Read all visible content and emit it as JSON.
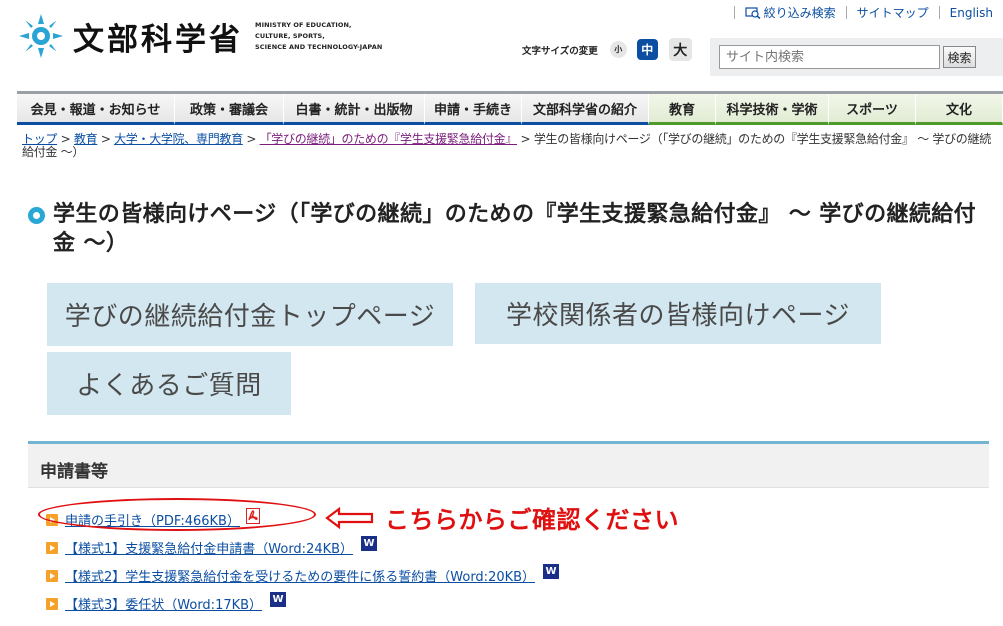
{
  "header": {
    "logo_jp": "文部科学省",
    "logo_en_lines": [
      "MINISTRY OF EDUCATION,",
      "CULTURE, SPORTS,",
      "SCIENCE AND TECHNOLOGY-JAPAN"
    ],
    "toplinks": [
      "絞り込み検索",
      "サイトマップ",
      "English"
    ],
    "fontsize_label": "文字サイズの変更",
    "fontsize_options": [
      "小",
      "中",
      "大"
    ],
    "search_placeholder": "サイト内検索",
    "search_button": "検索"
  },
  "nav": [
    {
      "label": "会見・報道・お知らせ",
      "theme": "blue"
    },
    {
      "label": "政策・審議会",
      "theme": "blue"
    },
    {
      "label": "白書・統計・出版物",
      "theme": "blue"
    },
    {
      "label": "申請・手続き",
      "theme": "blue"
    },
    {
      "label": "文部科学省の紹介",
      "theme": "blue"
    },
    {
      "label": "教育",
      "theme": "green"
    },
    {
      "label": "科学技術・学術",
      "theme": "green"
    },
    {
      "label": "スポーツ",
      "theme": "green"
    },
    {
      "label": "文化",
      "theme": "green"
    }
  ],
  "breadcrumb": {
    "links": [
      "トップ",
      "教育",
      "大学・大学院、専門教育",
      "「学びの継続」のための『学生支援緊急給付金』"
    ],
    "separator": " > ",
    "current": "学生の皆様向けページ（「学びの継続」のための『学生支援緊急給付金』 ～ 学びの継続給付金 ～）"
  },
  "page_title": "学生の皆様向けページ（「学びの継続」のための『学生支援緊急給付金』 ～ 学びの継続給付金 ～）",
  "big_buttons": [
    "学びの継続給付金トップページ",
    "学校関係者の皆様向けページ",
    "よくあるご質問"
  ],
  "section_title": "申請書等",
  "documents": [
    {
      "label": "申請の手引き（PDF:466KB）",
      "icon": "pdf-icon"
    },
    {
      "label": "【様式1】支援緊急給付金申請書（Word:24KB）",
      "icon": "word-icon"
    },
    {
      "label": "【様式2】学生支援緊急給付金を受けるための要件に係る誓約書（Word:20KB）",
      "icon": "word-icon"
    },
    {
      "label": "【様式3】委任状（Word:17KB）",
      "icon": "word-icon"
    }
  ],
  "word_icon_letter": "W",
  "annotation_text": "こちらからご確認ください",
  "colors": {
    "accent_blue": "#0b4ea2",
    "accent_green": "#4f9a2a",
    "annotation_red": "#e01010",
    "bullet_orange": "#f6a12a"
  }
}
